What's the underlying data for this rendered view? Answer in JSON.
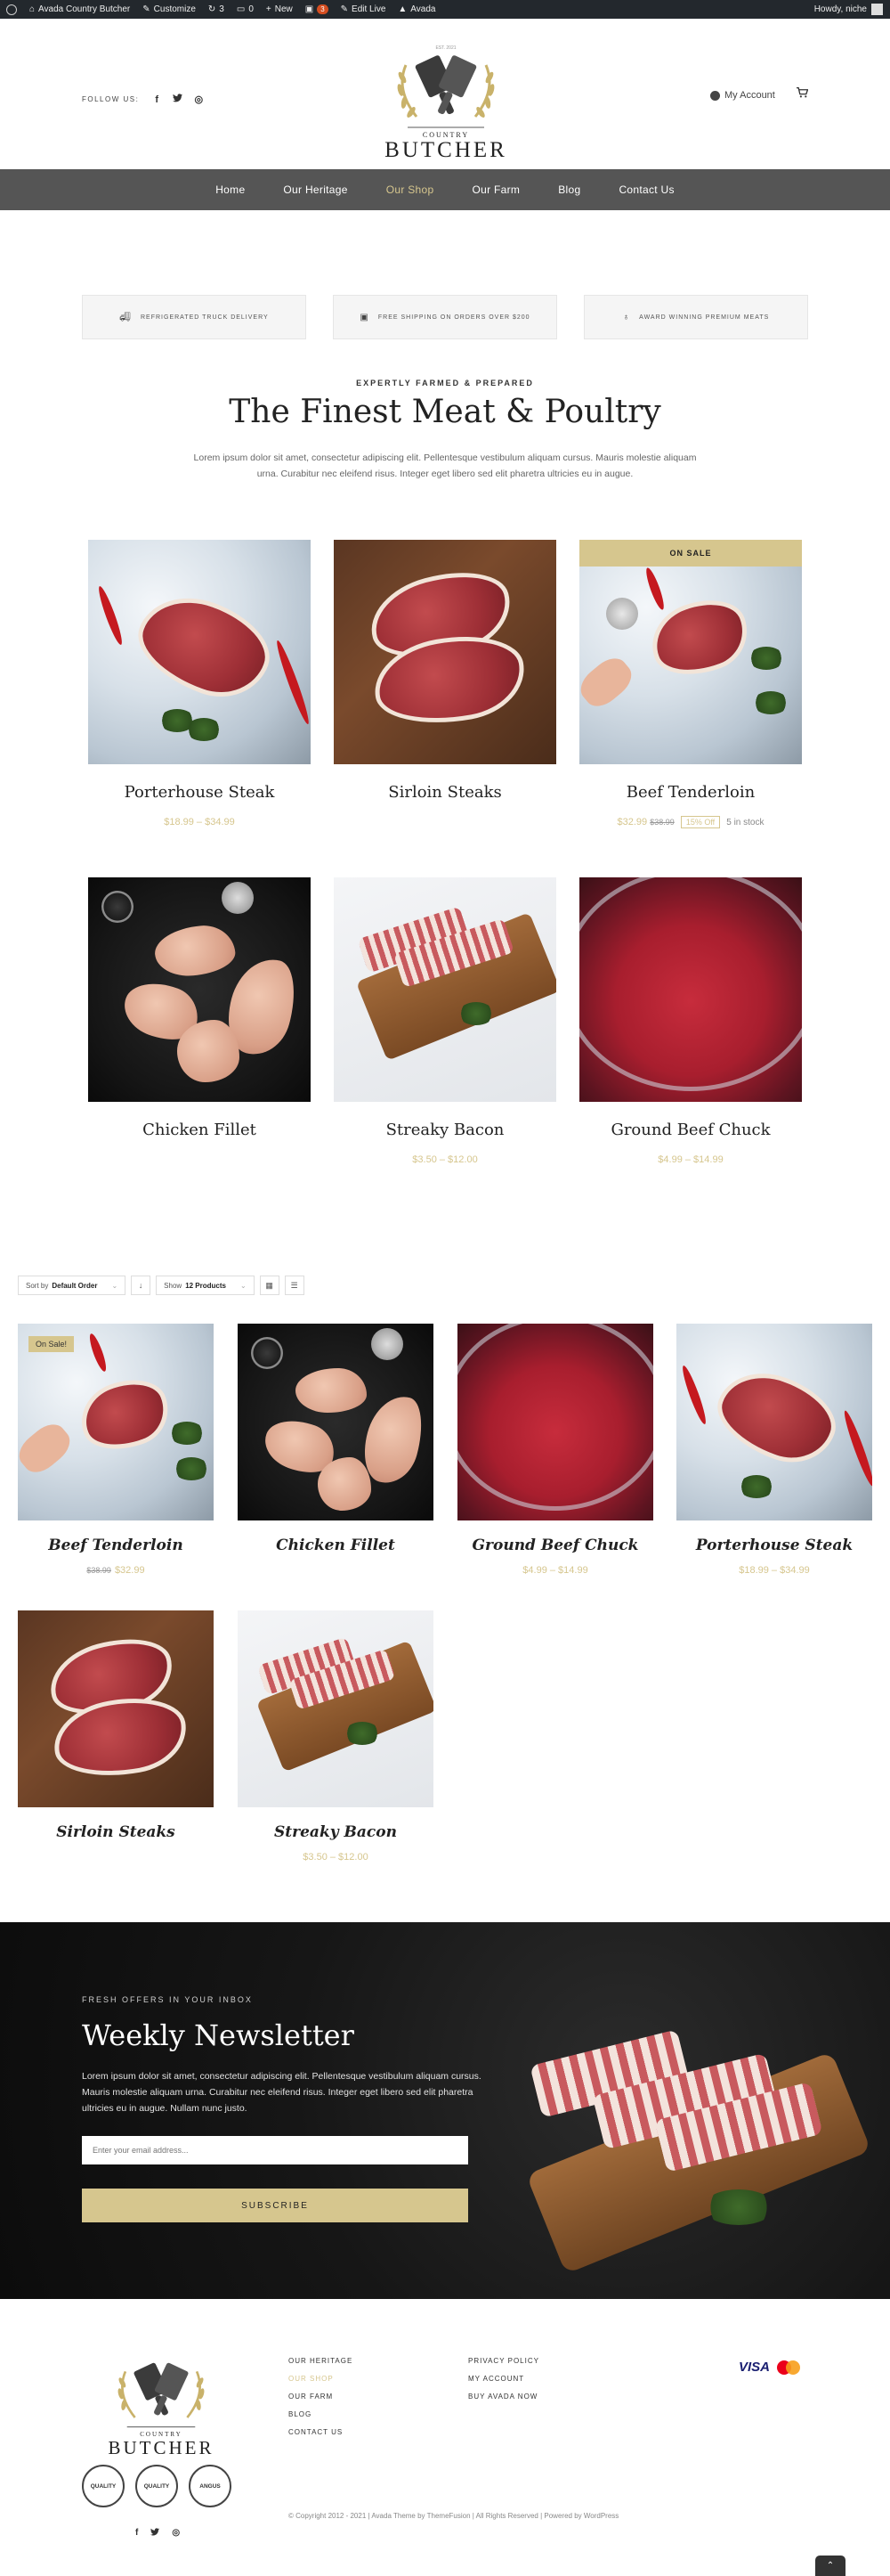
{
  "admin_bar": {
    "site": "Avada Country Butcher",
    "customize": "Customize",
    "updates": "3",
    "comments": "0",
    "new": "New",
    "badge": "3",
    "edit_live": "Edit Live",
    "avada": "Avada",
    "howdy": "Howdy, niche"
  },
  "header": {
    "follow_label": "FOLLOW US:",
    "socials": [
      "f",
      "t",
      "◎"
    ],
    "logo_line1": "COUNTRY",
    "logo_line2": "BUTCHER",
    "logo_est": "EST. 2021",
    "account_label": "My Account",
    "cart_icon": "cart-icon"
  },
  "nav": {
    "items": [
      "Home",
      "Our Heritage",
      "Our Shop",
      "Our Farm",
      "Blog",
      "Contact Us"
    ],
    "active": "Our Shop"
  },
  "features": [
    {
      "icon": "truck-icon",
      "label": "REFRIGERATED TRUCK DELIVERY"
    },
    {
      "icon": "gift-icon",
      "label": "FREE SHIPPING ON ORDERS OVER $200"
    },
    {
      "icon": "award-icon",
      "label": "AWARD WINNING PREMIUM MEATS"
    }
  ],
  "intro": {
    "kicker": "EXPERTLY FARMED & PREPARED",
    "title": "The Finest Meat & Poultry",
    "text": "Lorem ipsum dolor sit amet, consectetur adipiscing elit. Pellentesque vestibulum aliquam cursus. Mauris molestie aliquam urna. Curabitur nec eleifend risus. Integer eget libero sed elit pharetra ultricies eu in augue."
  },
  "featured": [
    {
      "name": "Porterhouse Steak",
      "price": "$18.99 – $34.99"
    },
    {
      "name": "Sirloin Steaks",
      "price": ""
    },
    {
      "name": "Beef Tenderloin",
      "price": "$32.99",
      "old_price": "$38.99",
      "off": "15% Off",
      "stock": "5 in stock",
      "banner": "ON SALE"
    },
    {
      "name": "Chicken Fillet",
      "price": ""
    },
    {
      "name": "Streaky Bacon",
      "price": "$3.50 – $12.00"
    },
    {
      "name": "Ground Beef Chuck",
      "price": "$4.99 – $14.99"
    }
  ],
  "toolbar": {
    "sort_prefix": "Sort by",
    "sort_value": "Default Order",
    "show_prefix": "Show",
    "show_value": "12 Products",
    "caret": "⌄",
    "direction": "↓",
    "grid_icon": "▦",
    "list_icon": "☰"
  },
  "shop": [
    {
      "name": "Beef Tenderloin",
      "old_price": "$38.99",
      "price": "$32.99",
      "badge": "On Sale!"
    },
    {
      "name": "Chicken Fillet",
      "price": ""
    },
    {
      "name": "Ground Beef Chuck",
      "price": "$4.99 – $14.99"
    },
    {
      "name": "Porterhouse Steak",
      "price": "$18.99 – $34.99"
    },
    {
      "name": "Sirloin Steaks",
      "price": ""
    },
    {
      "name": "Streaky Bacon",
      "price": "$3.50 – $12.00"
    }
  ],
  "newsletter": {
    "kicker": "FRESH OFFERS IN YOUR INBOX",
    "title": "Weekly Newsletter",
    "text": "Lorem ipsum dolor sit amet, consectetur adipiscing elit. Pellentesque vestibulum aliquam cursus. Mauris molestie aliquam urna. Curabitur nec eleifend risus. Integer eget libero sed elit pharetra ultricies eu in augue. Nullam nunc justo.",
    "placeholder": "Enter your email address...",
    "button": "SUBSCRIBE"
  },
  "footer": {
    "col1": [
      "OUR HERITAGE",
      "OUR SHOP",
      "OUR FARM",
      "BLOG",
      "CONTACT US"
    ],
    "col1_active": "OUR SHOP",
    "col2": [
      "PRIVACY POLICY",
      "MY ACCOUNT",
      "BUY AVADA NOW"
    ],
    "badges": [
      "QUALITY",
      "QUALITY",
      "ANGUS"
    ],
    "socials": [
      "f",
      "t",
      "◎"
    ],
    "visa": "VISA",
    "copyright": "© Copyright 2012 - 2021 | Avada Theme by ThemeFusion | All Rights Reserved | Powered by WordPress",
    "totop": "⌃"
  },
  "colors": {
    "accent": "#d6c68e",
    "nav_bg": "#555555",
    "dark": "#161616"
  }
}
